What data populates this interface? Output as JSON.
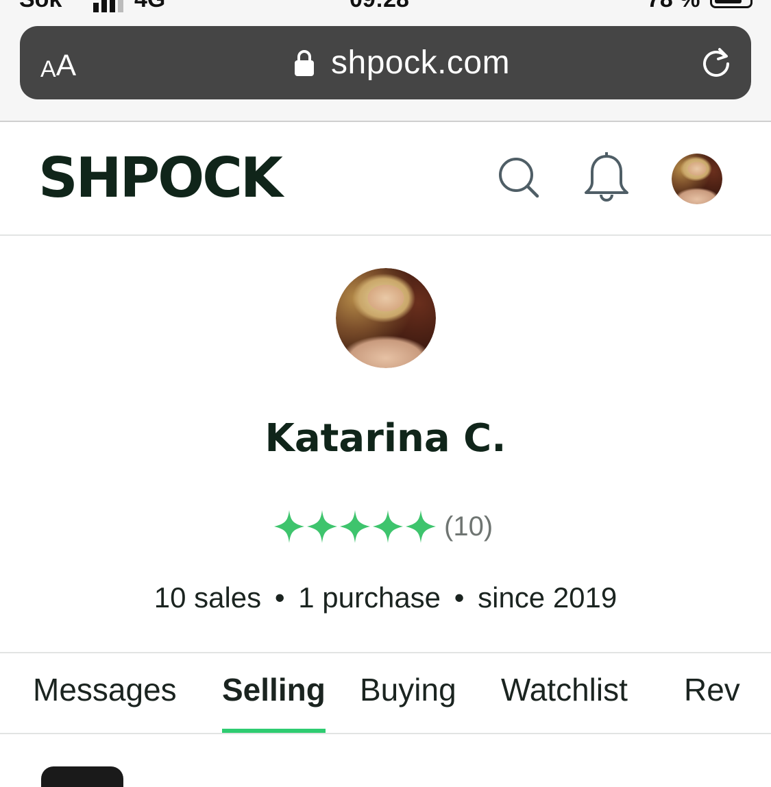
{
  "status_bar": {
    "carrier": "Sok",
    "network": "4G",
    "time": "09:28",
    "battery_percent": "78 %"
  },
  "browser": {
    "aa_small": "A",
    "aa_big": "A",
    "url": "shpock.com"
  },
  "header": {
    "logo": "SHPOCK",
    "icons": [
      "search-icon",
      "bell-icon",
      "avatar"
    ]
  },
  "profile": {
    "name": "Katarina C.",
    "rating": 5,
    "review_count": "(10)",
    "stats": {
      "sales": "10 sales",
      "purchases": "1 purchase",
      "since": "since 2019",
      "separator": "•"
    }
  },
  "tabs": [
    {
      "label": "Messages",
      "active": false
    },
    {
      "label": "Selling",
      "active": true
    },
    {
      "label": "Buying",
      "active": false
    },
    {
      "label": "Watchlist",
      "active": false
    },
    {
      "label": "Rev",
      "active": false
    }
  ],
  "colors": {
    "accent_green": "#2ecc71",
    "star_green": "#3ec46d",
    "logo_dark": "#10251a",
    "url_bar": "#454545"
  }
}
